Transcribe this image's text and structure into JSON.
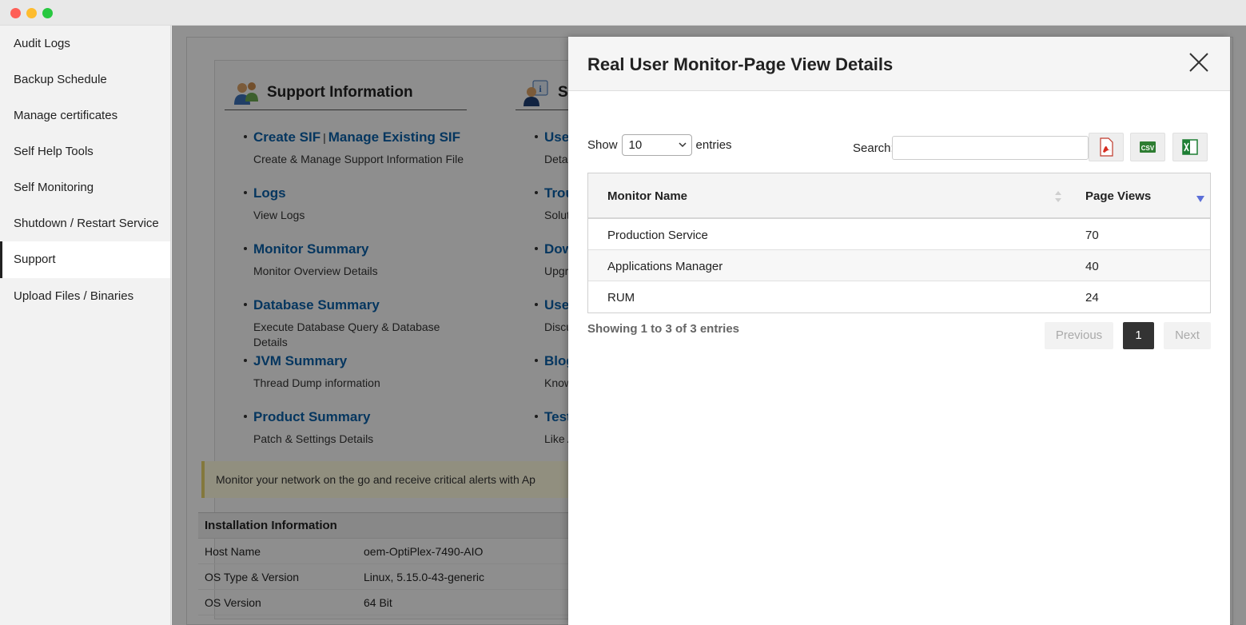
{
  "sidebar": {
    "items": [
      {
        "label": "Audit Logs"
      },
      {
        "label": "Backup Schedule"
      },
      {
        "label": "Manage certificates"
      },
      {
        "label": "Self Help Tools"
      },
      {
        "label": "Self Monitoring"
      },
      {
        "label": "Shutdown / Restart Service"
      },
      {
        "label": "Support",
        "active": true
      },
      {
        "label": "Upload Files / Binaries"
      }
    ]
  },
  "support": {
    "left_title": "Support Information",
    "right_title": "S",
    "left_links": [
      {
        "title": "Create SIF",
        "title2": "Manage Existing SIF",
        "sep": "|",
        "desc": "Create & Manage Support Information File"
      },
      {
        "title": "Logs",
        "desc": "View Logs"
      },
      {
        "title": "Monitor Summary",
        "desc": "Monitor Overview Details"
      },
      {
        "title": "Database Summary",
        "desc": "Execute Database Query & Database Details"
      },
      {
        "title": "JVM Summary",
        "desc": "Thread Dump information"
      },
      {
        "title": "Product Summary",
        "desc": "Patch & Settings Details"
      }
    ],
    "right_links": [
      {
        "title": "User",
        "desc": "Detai"
      },
      {
        "title": "Trou",
        "desc": "Solut"
      },
      {
        "title": "Dow",
        "desc": "Upgra"
      },
      {
        "title": "User",
        "desc": "Discu"
      },
      {
        "title": "Blog",
        "desc": "Know"
      },
      {
        "title": "Test",
        "desc": "Like A"
      }
    ],
    "alert": "Monitor your network on the go and receive critical alerts with Ap",
    "installation": {
      "title": "Installation Information",
      "rows": [
        {
          "key": "Host Name",
          "value": "oem-OptiPlex-7490-AIO"
        },
        {
          "key": "OS Type & Version",
          "value": "Linux, 5.15.0-43-generic"
        },
        {
          "key": "OS Version",
          "value": "64 Bit"
        }
      ]
    }
  },
  "modal": {
    "title": "Real User Monitor-Page View Details",
    "show_label": "Show",
    "entries_value": "10",
    "entries_label": "entries",
    "search_label": "Search:",
    "search_value": "",
    "export_buttons": [
      "pdf-icon",
      "csv-icon",
      "excel-icon"
    ],
    "columns": [
      "Monitor Name",
      "Page Views"
    ],
    "rows": [
      {
        "name": "Production Service",
        "views": "70"
      },
      {
        "name": "Applications Manager",
        "views": "40"
      },
      {
        "name": "RUM",
        "views": "24"
      }
    ],
    "info": "Showing 1 to 3 of 3 entries",
    "pagination": {
      "prev": "Previous",
      "current": "1",
      "next": "Next"
    }
  },
  "colors": {
    "link": "#0a5fa8",
    "active_page": "#333333",
    "sort_indicator": "#5b6ed8"
  }
}
